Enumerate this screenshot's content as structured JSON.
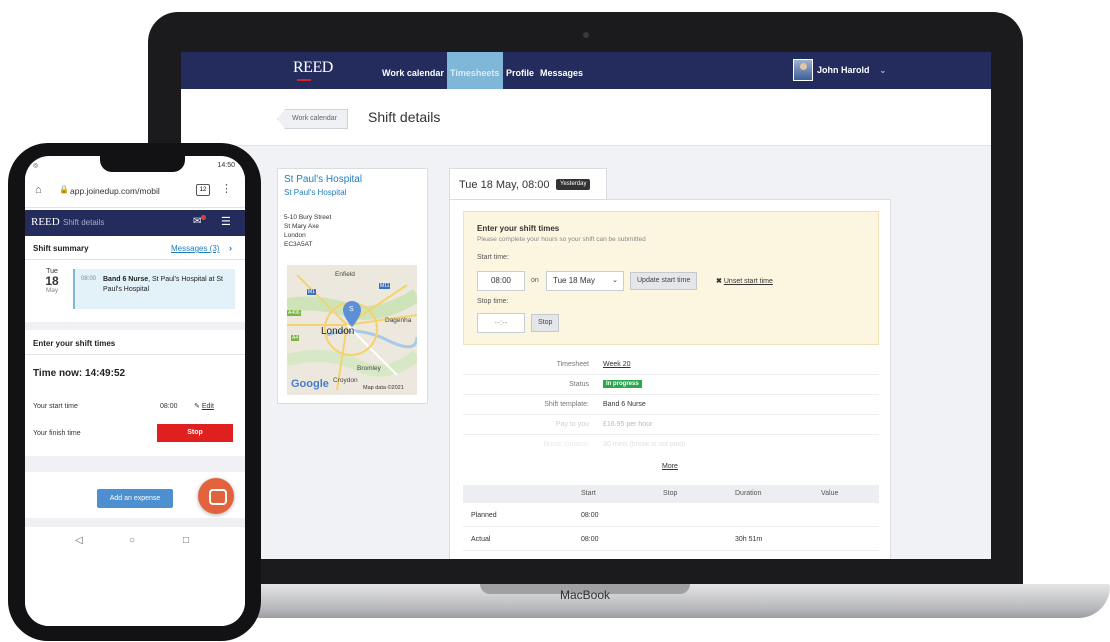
{
  "laptop": {
    "brand": "MacBook",
    "nav": {
      "logo": "REED",
      "items": [
        {
          "label": "Work calendar",
          "active": false
        },
        {
          "label": "Timesheets",
          "active": true
        },
        {
          "label": "Profile",
          "active": false
        },
        {
          "label": "Messages",
          "active": false
        }
      ],
      "user_name": "John Harold"
    },
    "header": {
      "back_label": "Work calendar",
      "title": "Shift details"
    },
    "hospital": {
      "name": "St Paul's Hospital",
      "subname": "St Paul's Hospital",
      "address": [
        "5-10 Bury Street",
        "St Mary Axe",
        "London",
        "EC3A5AT"
      ],
      "map": {
        "labels": [
          "Enfield",
          "London",
          "Dagenha",
          "Bromley",
          "Croydon"
        ],
        "roads": [
          "M1",
          "M11",
          "A406",
          "A4"
        ],
        "pin": "S",
        "brand": "Google",
        "credit": "Map data ©2021"
      }
    },
    "shift": {
      "tab_title": "Tue 18 May, 08:00",
      "badge": "Yesterday",
      "enter": {
        "title": "Enter your shift times",
        "note": "Please complete your hours so your shift can be submitted",
        "start_label": "Start time:",
        "start_value": "08:00",
        "on_label": "on",
        "date_value": "Tue 18 May",
        "update_button": "Update start time",
        "unset_link": "Unset start time",
        "stop_label": "Stop time:",
        "stop_placeholder": "--:--",
        "stop_button": "Stop"
      },
      "details": [
        {
          "key": "Timesheet",
          "value": "Week 20"
        },
        {
          "key": "Status",
          "value": "In progress"
        },
        {
          "key": "Shift template:",
          "value": "Band 6 Nurse"
        },
        {
          "key": "Pay to you",
          "value": "£16.95 per hour"
        },
        {
          "key": "Break duration",
          "value": "30 mins (break is not paid)"
        }
      ],
      "more_link": "More",
      "times": {
        "headers": [
          "",
          "Start",
          "Stop",
          "Duration",
          "Value"
        ],
        "rows": [
          [
            "Planned",
            "08:00",
            "",
            "",
            ""
          ],
          [
            "Actual",
            "08:00",
            "",
            "30h 51m",
            ""
          ]
        ]
      }
    }
  },
  "phone": {
    "status_time": "14:50",
    "url": "app.joinedup.com/mobil",
    "tab_count": "12",
    "nav": {
      "logo": "REED",
      "title": "Shift details"
    },
    "summary": {
      "title": "Shift summary",
      "messages_link": "Messages (3)",
      "date": {
        "dow": "Tue",
        "day": "18",
        "month": "May"
      },
      "shift_time": "08:00",
      "shift_role": "Band 6 Nurse",
      "shift_place": ", St Paul's Hospital at St Paul's Hospital"
    },
    "enter": {
      "title": "Enter your shift times",
      "time_now": "Time now: 14:49:52",
      "start_label": "Your start time",
      "start_value": "08:00",
      "edit_label": "Edit",
      "finish_label": "Your finish time",
      "stop_button": "Stop"
    },
    "expense_button": "Add an expense"
  }
}
